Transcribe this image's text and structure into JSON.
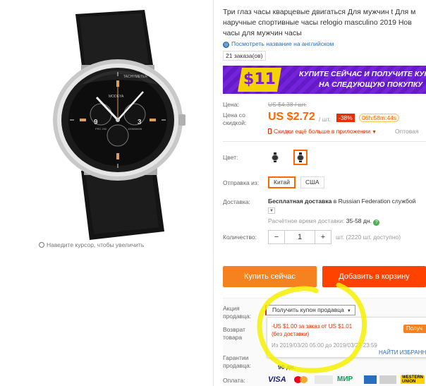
{
  "product": {
    "title_lines": [
      "Три глаз часы кварцевые двигаться Для мужчин t Для м",
      "наручные спортивные часы relogio masculino 2019 Нов",
      "часы для мужчин часы"
    ],
    "translate_link": "Посмотреть название на английском",
    "orders": "21 заказа(ов)",
    "zoom_hint": "Наведите курсор, чтобы увеличить",
    "watch_text_brand": "MODEYA",
    "watch_text_tachy": "TACHYMETER",
    "watch_text_prc": "PRC 200",
    "watch_text_depth": "100M/660ft"
  },
  "banner": {
    "amount": "$11",
    "line1": "КУПИТЕ СЕЙЧАС И ПОЛУЧИТЕ КУПО",
    "line2": "НА СЛЕДУЮЩУЮ ПОКУПКУ",
    "colors": {
      "bg": "#6c1fd3",
      "badge": "#f5d300"
    }
  },
  "price": {
    "label_price": "Цена:",
    "old": "US $4.38 / шт.",
    "label_discount_line1": "Цена со",
    "label_discount_line2": "скидкой:",
    "new": "US $2.72",
    "per": "/ шт.",
    "discount_badge": "-38%",
    "timer": "06h:58m:44s",
    "app_discount": "Скидки ещё больше в приложении",
    "wholesale": "Оптовая"
  },
  "color": {
    "label": "Цвет:"
  },
  "shipping": {
    "label": "Отправка из:",
    "options": [
      "Китай",
      "США"
    ],
    "selected": "Китай"
  },
  "delivery": {
    "label": "Доставка:",
    "free_text": "Бесплатная доставка",
    "to_text": " в Russian Federation службой",
    "estimate_label": "Расчётное время доставки:",
    "estimate_value": "35-58 дн.",
    "help": "?"
  },
  "quantity": {
    "label": "Количество:",
    "minus": "−",
    "value": "1",
    "plus": "+",
    "available": "шт. (2220 шт. доступно)"
  },
  "actions": {
    "buy_now": "Купить сейчас",
    "add_to_cart": "Добавить в корзину"
  },
  "seller": {
    "promo_label_line1": "Акция",
    "promo_label_line2": "продавца:",
    "coupon_button": "Получить купон продавца",
    "coupon_line1": "-US $1.00 за заказ от US $1.01",
    "coupon_line2": "(без доставки)",
    "coupon_dates": "Из 2019/03/20 05:00 до 2019/03/27 23:59",
    "coupon_get": "Получ",
    "coupon_more": "НАЙТИ ИЗБРАНН",
    "return_line1": "Возврат",
    "return_line2": "товара",
    "guarantee_line1": "Гарантии",
    "guarantee_line2": "продавца:",
    "guarantee_days": "90 дн.",
    "payment_label": "Оплата:"
  },
  "payments": {
    "visa": "VISA",
    "mir": "МИР",
    "wu_line1": "WESTERN",
    "wu_line2": "UNION"
  }
}
